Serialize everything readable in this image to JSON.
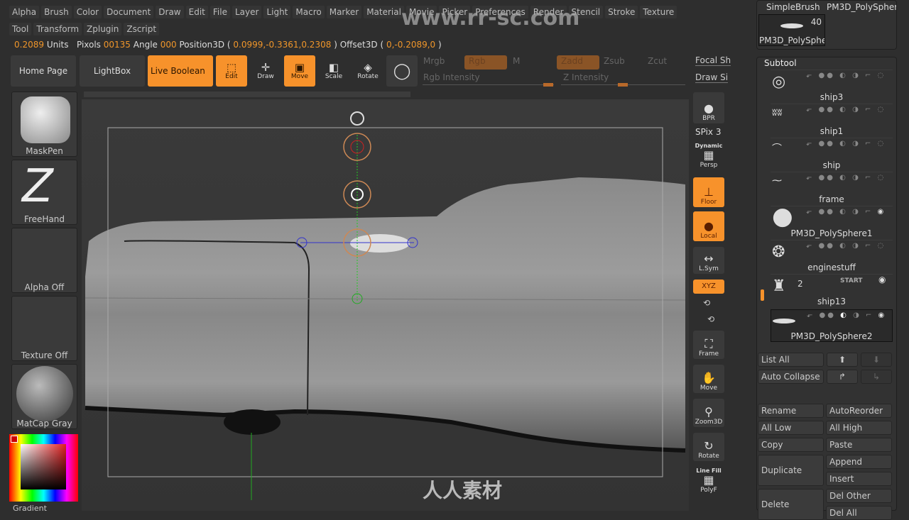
{
  "menu": {
    "row1": [
      "Alpha",
      "Brush",
      "Color",
      "Document",
      "Draw",
      "Edit",
      "File",
      "Layer",
      "Light",
      "Macro",
      "Marker",
      "Material",
      "Movie",
      "Picker",
      "Preferences",
      "Render",
      "Stencil",
      "Stroke",
      "Texture"
    ],
    "row2": [
      "Tool",
      "Transform",
      "Zplugin",
      "Zscript"
    ]
  },
  "watermark": "www.rr-sc.com",
  "info": {
    "units_val": "0.2089",
    "units": "Units",
    "pixols_label": "Pixols",
    "pixols_val": "00135",
    "angle_label": "Angle",
    "angle_val": "000",
    "pos_label": "Position3D (",
    "pos_val": "0.0999,-0.3361,0.2308",
    "pos_end": ")",
    "off_label": "Offset3D (",
    "off_val": "0,-0.2089,0",
    "off_end": ")"
  },
  "toolbar": {
    "home": "Home Page",
    "lightbox": "LightBox",
    "live_boolean": "Live Boolean",
    "edit": "Edit",
    "draw": "Draw",
    "move": "Move",
    "scale": "Scale",
    "rotate": "Rotate",
    "mrgb": "Mrgb",
    "rgb": "Rgb",
    "m": "M",
    "zadd": "Zadd",
    "zsub": "Zsub",
    "zcut": "Zcut",
    "rgb_intensity": "Rgb Intensity",
    "z_intensity": "Z Intensity",
    "focal": "Focal Sh",
    "draw_size": "Draw Si"
  },
  "left_shelf": [
    {
      "label": "MaskPen"
    },
    {
      "label": "FreeHand"
    },
    {
      "label": "Alpha Off"
    },
    {
      "label": "Texture Off"
    },
    {
      "label": "MatCap Gray"
    },
    {
      "label": "Gradient"
    }
  ],
  "right_shelf": {
    "bpr": "BPR",
    "spix": "SPix 3",
    "dynamic": "Dynamic",
    "persp": "Persp",
    "floor": "Floor",
    "local": "Local",
    "lsym": "L.Sym",
    "xyz": "XYZ",
    "frame": "Frame",
    "move": "Move",
    "zoom3d": "Zoom3D",
    "rotate": "Rotate",
    "linefill": "Line Fill",
    "polyf": "PolyF"
  },
  "tool": {
    "simple_brush": "SimpleBrush",
    "current_name": "PM3D_PolySpher",
    "thumb_name": "PM3D_PolySpher",
    "count": "40"
  },
  "subtool": {
    "title": "Subtool",
    "items": [
      {
        "name": "ship3",
        "visible": false
      },
      {
        "name": "ship1",
        "visible": false
      },
      {
        "name": "ship",
        "visible": false
      },
      {
        "name": "frame",
        "visible": false
      },
      {
        "name": "PM3D_PolySphere1",
        "visible": true
      },
      {
        "name": "enginestuff",
        "visible": false
      },
      {
        "name": "ship13",
        "visible": true,
        "level": "2",
        "tag": "START"
      },
      {
        "name": "PM3D_PolySphere2",
        "visible": true,
        "selected": true
      }
    ]
  },
  "subtool_buttons": {
    "list_all": "List All",
    "auto_collapse": "Auto Collapse",
    "rename": "Rename",
    "autoreorder": "AutoReorder",
    "all_low": "All Low",
    "all_high": "All High",
    "copy": "Copy",
    "paste": "Paste",
    "duplicate": "Duplicate",
    "append": "Append",
    "insert": "Insert",
    "del_other": "Del Other",
    "delete": "Delete",
    "del_all": "Del All"
  },
  "logo_text": "人人素材",
  "colors": {
    "accent": "#f7922b",
    "bg": "#2e2e2e"
  }
}
